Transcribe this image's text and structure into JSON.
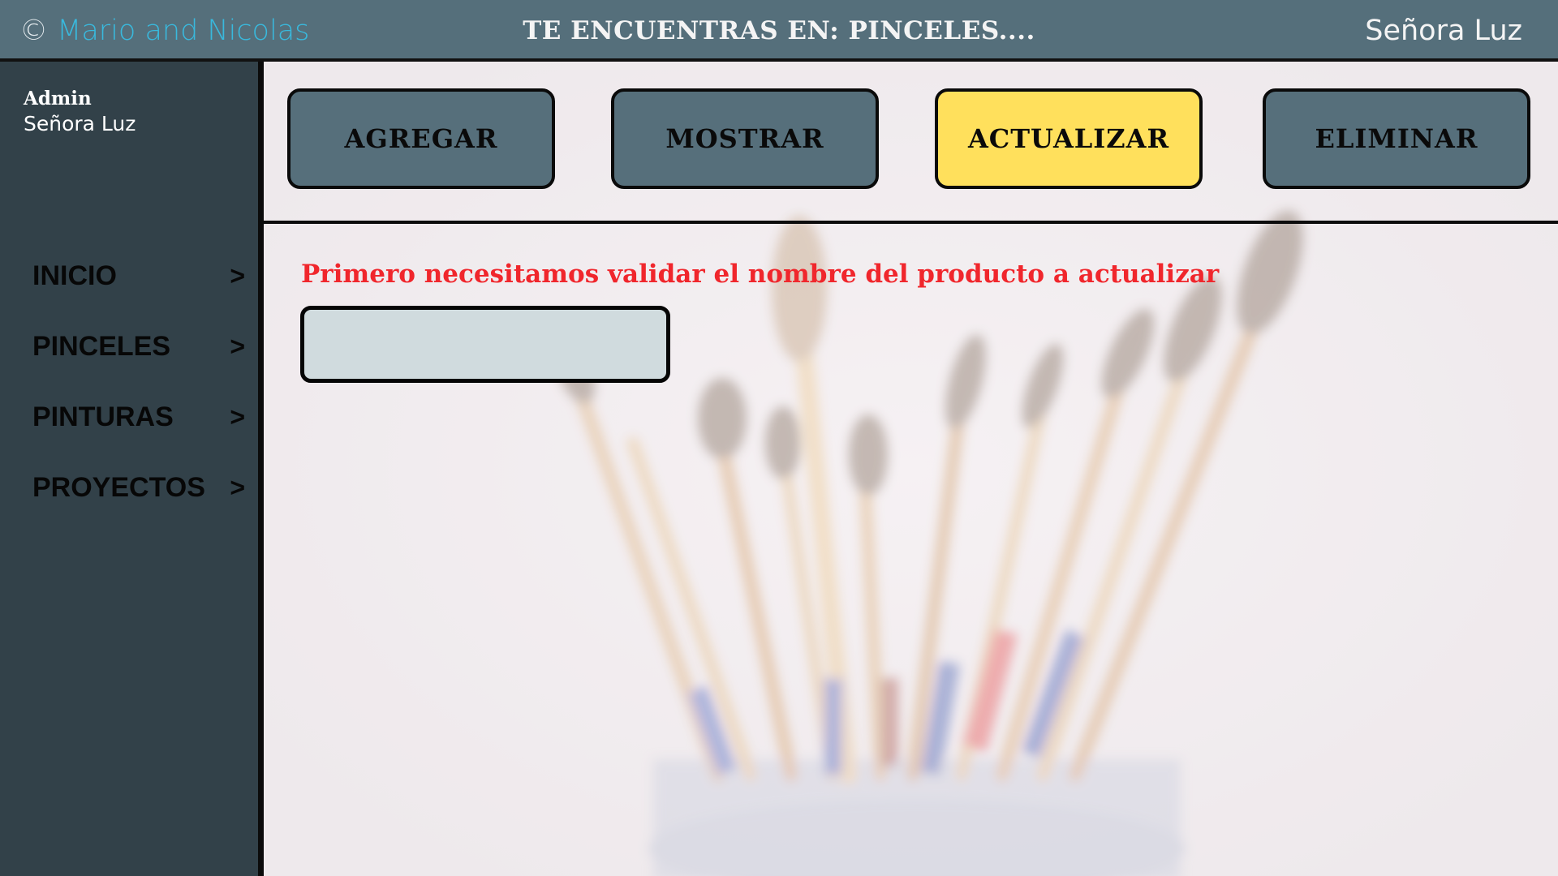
{
  "header": {
    "copyright_symbol": "©",
    "copyright_names": "Mario and Nicolas",
    "location": "TE ENCUENTRAS EN: PINCELES....",
    "user": "Señora Luz"
  },
  "sidebar": {
    "role": "Admin",
    "user": "Señora Luz",
    "items": [
      {
        "label": "INICIO",
        "chevron": ">"
      },
      {
        "label": "PINCELES",
        "chevron": ">"
      },
      {
        "label": "PINTURAS",
        "chevron": ">"
      },
      {
        "label": "PROYECTOS",
        "chevron": ">"
      }
    ]
  },
  "actions": [
    {
      "label": "AGREGAR"
    },
    {
      "label": "MOSTRAR"
    },
    {
      "label": "ACTUALIZAR"
    },
    {
      "label": "ELIMINAR"
    }
  ],
  "main": {
    "prompt": "Primero necesitamos validar el nombre del producto a actualizar",
    "input_value": "",
    "input_placeholder": ""
  },
  "colors": {
    "header_bg": "#556f7b",
    "sidebar_bg": "#324149",
    "button_bg": "#566f7b",
    "button_active": "#ffe05c",
    "prompt_text": "#f0262c",
    "brand_link": "#39b9dd",
    "input_bg": "#d0dbde"
  },
  "icons": {
    "nav_chevron": "chevron-right-icon",
    "background": "paintbrushes-jar-photo"
  }
}
